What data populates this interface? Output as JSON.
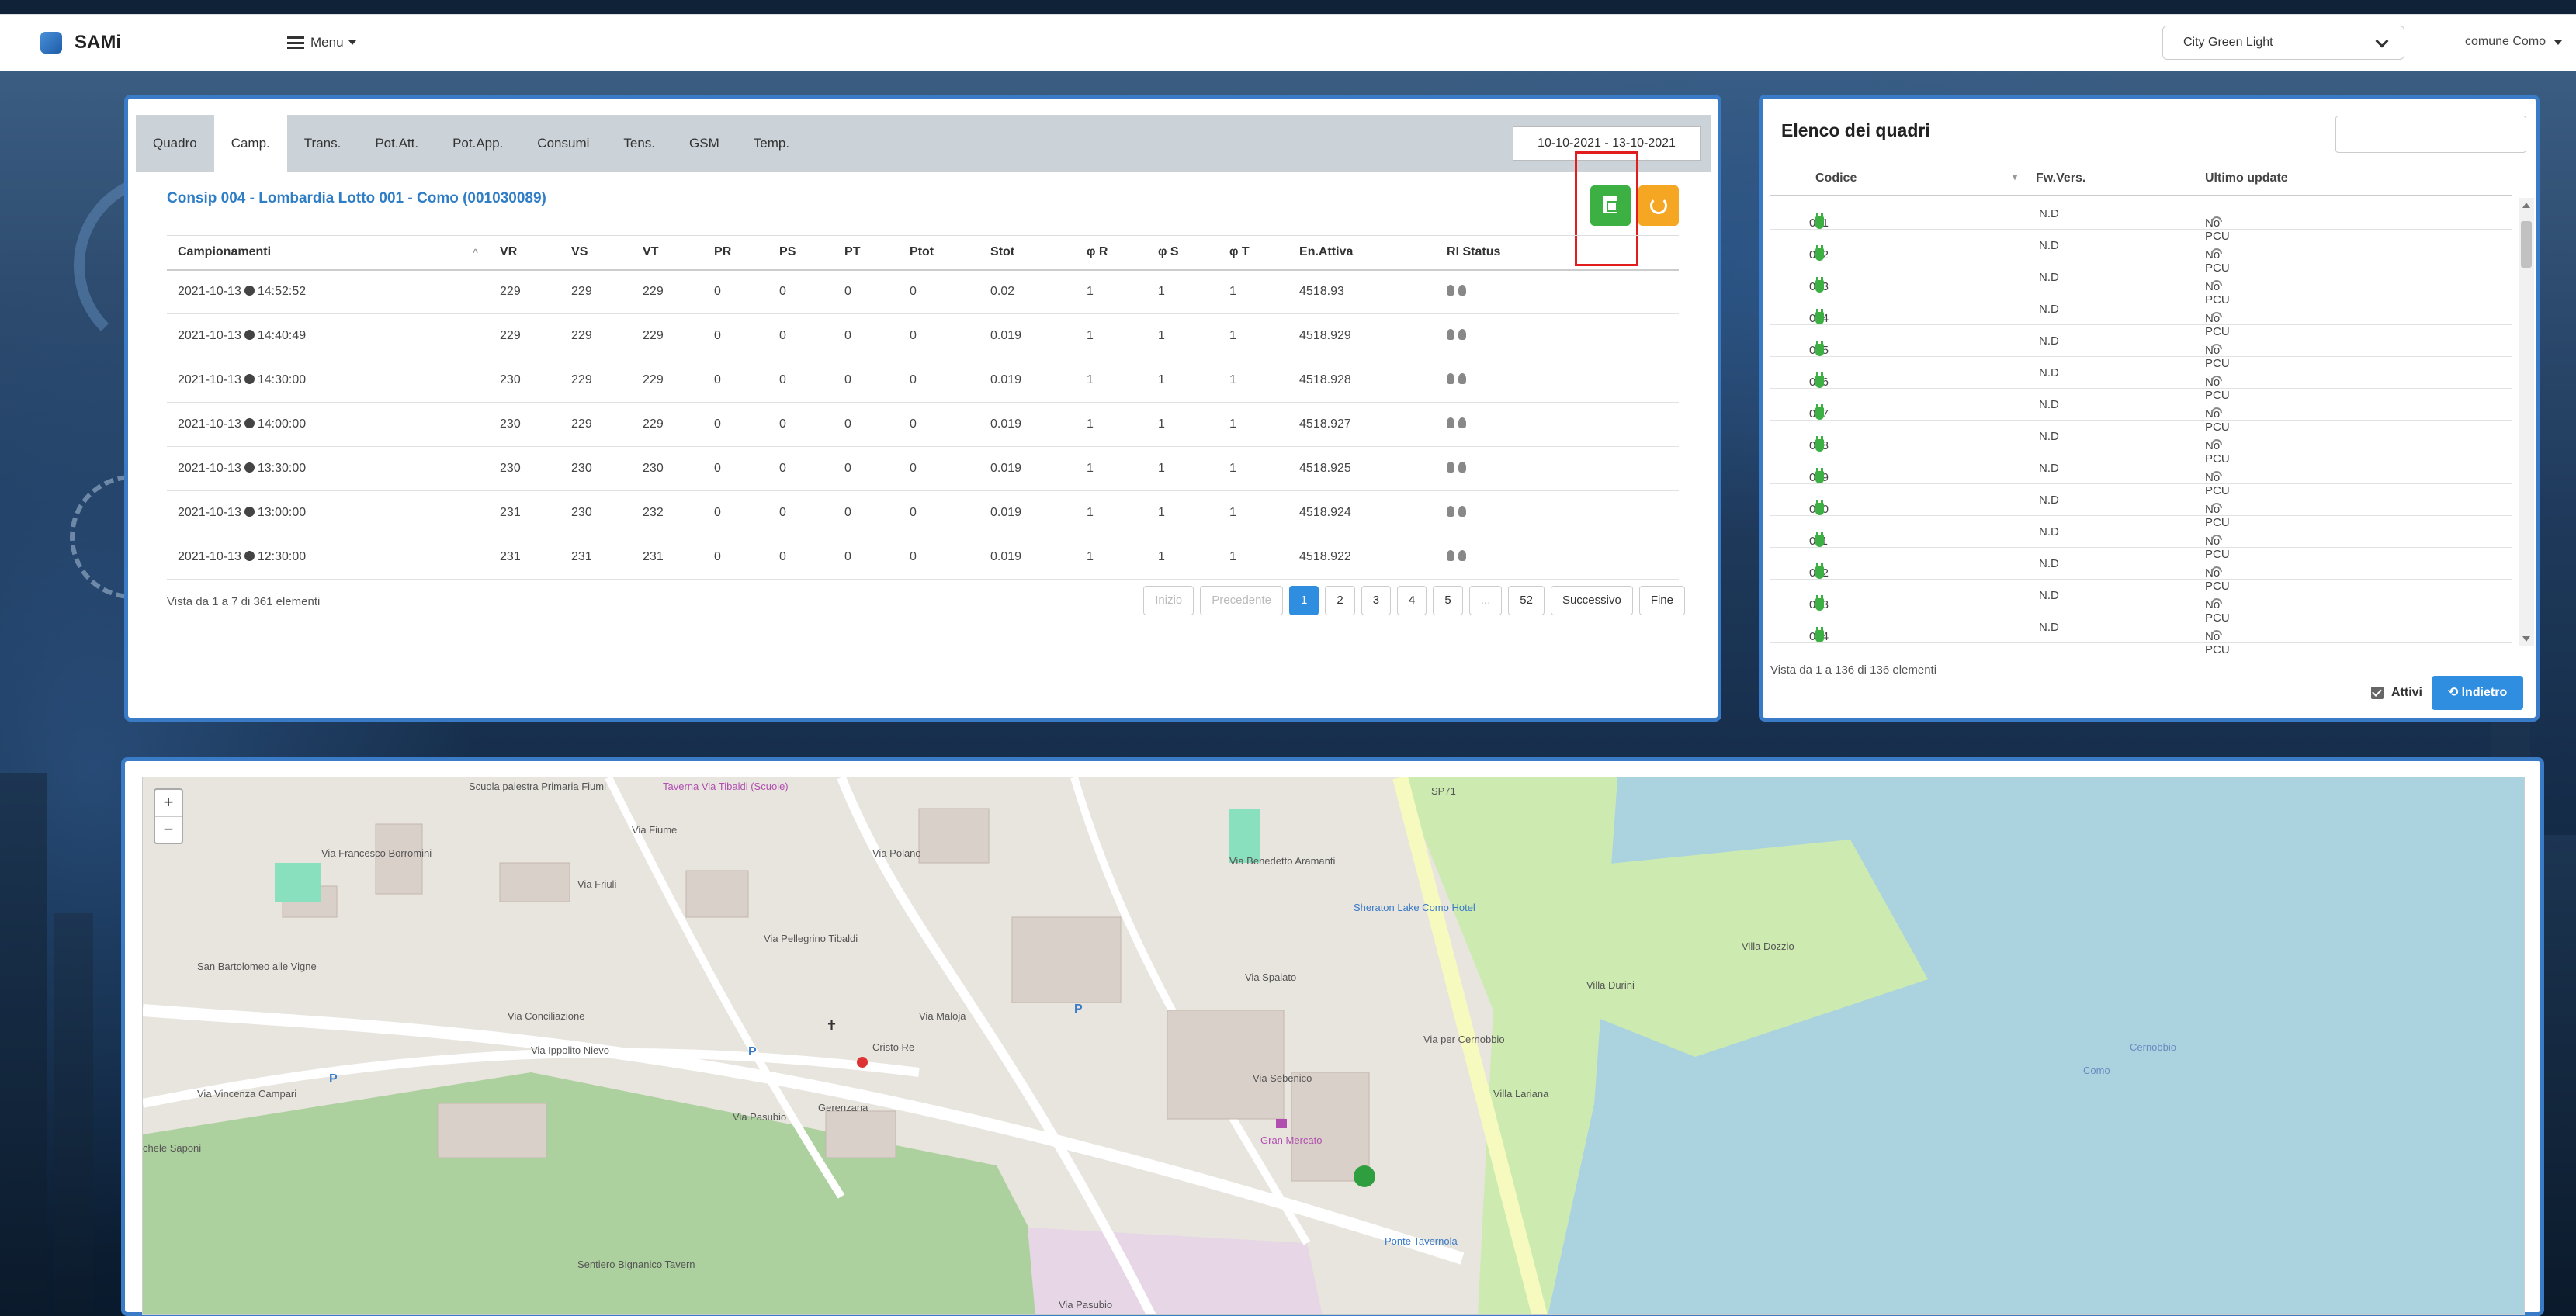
{
  "app": {
    "name": "SAMi"
  },
  "navbar": {
    "menu_label": "Menu",
    "selected_group": "City Green Light",
    "user_label": "comune Como"
  },
  "tabs": [
    "Quadro",
    "Camp.",
    "Trans.",
    "Pot.Att.",
    "Pot.App.",
    "Consumi",
    "Tens.",
    "GSM",
    "Temp."
  ],
  "active_tab": "Camp.",
  "date_range": "10-10-2021 - 13-10-2021",
  "subtitle": "Consip 004 - Lombardia Lotto 001 - Como (001030089)",
  "table": {
    "columns": [
      "Campionamenti",
      "VR",
      "VS",
      "VT",
      "PR",
      "PS",
      "PT",
      "Ptot",
      "Stot",
      "φ R",
      "φ S",
      "φ T",
      "En.Attiva",
      "RI Status"
    ],
    "rows": [
      {
        "date": "2021-10-13",
        "time": "14:52:52",
        "vr": "229",
        "vs": "229",
        "vt": "229",
        "pr": "0",
        "ps": "0",
        "pt": "0",
        "ptot": "0",
        "stot": "0.02",
        "phr": "1",
        "phs": "1",
        "pht": "1",
        "en": "4518.93"
      },
      {
        "date": "2021-10-13",
        "time": "14:40:49",
        "vr": "229",
        "vs": "229",
        "vt": "229",
        "pr": "0",
        "ps": "0",
        "pt": "0",
        "ptot": "0",
        "stot": "0.019",
        "phr": "1",
        "phs": "1",
        "pht": "1",
        "en": "4518.929"
      },
      {
        "date": "2021-10-13",
        "time": "14:30:00",
        "vr": "230",
        "vs": "229",
        "vt": "229",
        "pr": "0",
        "ps": "0",
        "pt": "0",
        "ptot": "0",
        "stot": "0.019",
        "phr": "1",
        "phs": "1",
        "pht": "1",
        "en": "4518.928"
      },
      {
        "date": "2021-10-13",
        "time": "14:00:00",
        "vr": "230",
        "vs": "229",
        "vt": "229",
        "pr": "0",
        "ps": "0",
        "pt": "0",
        "ptot": "0",
        "stot": "0.019",
        "phr": "1",
        "phs": "1",
        "pht": "1",
        "en": "4518.927"
      },
      {
        "date": "2021-10-13",
        "time": "13:30:00",
        "vr": "230",
        "vs": "230",
        "vt": "230",
        "pr": "0",
        "ps": "0",
        "pt": "0",
        "ptot": "0",
        "stot": "0.019",
        "phr": "1",
        "phs": "1",
        "pht": "1",
        "en": "4518.925"
      },
      {
        "date": "2021-10-13",
        "time": "13:00:00",
        "vr": "231",
        "vs": "230",
        "vt": "232",
        "pr": "0",
        "ps": "0",
        "pt": "0",
        "ptot": "0",
        "stot": "0.019",
        "phr": "1",
        "phs": "1",
        "pht": "1",
        "en": "4518.924"
      },
      {
        "date": "2021-10-13",
        "time": "12:30:00",
        "vr": "231",
        "vs": "231",
        "vt": "231",
        "pr": "0",
        "ps": "0",
        "pt": "0",
        "ptot": "0",
        "stot": "0.019",
        "phr": "1",
        "phs": "1",
        "pht": "1",
        "en": "4518.922"
      }
    ],
    "info": "Vista da 1 a 7 di 361 elementi"
  },
  "pagination": {
    "first": "Inizio",
    "prev": "Precedente",
    "pages": [
      "1",
      "2",
      "3",
      "4",
      "5",
      "...",
      "52"
    ],
    "active_page": "1",
    "next": "Successivo",
    "last": "Fine"
  },
  "quadri": {
    "title": "Elenco dei quadri",
    "columns": [
      "Codice",
      "Fw.Vers.",
      "Ultimo update"
    ],
    "rows": [
      {
        "code": "001",
        "fw": "N.D",
        "update": "No PCU"
      },
      {
        "code": "002",
        "fw": "N.D",
        "update": "No PCU"
      },
      {
        "code": "003",
        "fw": "N.D",
        "update": "No PCU"
      },
      {
        "code": "004",
        "fw": "N.D",
        "update": "No PCU"
      },
      {
        "code": "005",
        "fw": "N.D",
        "update": "No PCU"
      },
      {
        "code": "006",
        "fw": "N.D",
        "update": "No PCU"
      },
      {
        "code": "007",
        "fw": "N.D",
        "update": "No PCU"
      },
      {
        "code": "008",
        "fw": "N.D",
        "update": "No PCU"
      },
      {
        "code": "009",
        "fw": "N.D",
        "update": "No PCU"
      },
      {
        "code": "010",
        "fw": "N.D",
        "update": "No PCU"
      },
      {
        "code": "011",
        "fw": "N.D",
        "update": "No PCU"
      },
      {
        "code": "012",
        "fw": "N.D",
        "update": "No PCU"
      },
      {
        "code": "013",
        "fw": "N.D",
        "update": "No PCU"
      },
      {
        "code": "014",
        "fw": "N.D",
        "update": "No PCU"
      }
    ],
    "info": "Vista da 1 a 136 di 136 elementi",
    "active_label": "Attivi",
    "back_label": "Indietro"
  },
  "map": {
    "zoom_in": "+",
    "zoom_out": "−",
    "labels": [
      "San Bartolomeo alle Vigne",
      "Via Conciliazione",
      "Via Ippolito Nievo",
      "Via Vincenza Campari",
      "Via Pasubio",
      "Gerenzana",
      "Cristo Re",
      "Via Maloja",
      "Via Polano",
      "Via Spalato",
      "Via Sebenico",
      "Via Benedetto Aramanti",
      "Sheraton Lake Como Hotel",
      "Villa Dozzio",
      "Villa Durini",
      "Villa Lariana",
      "Gran Mercato",
      "Via per Cernobbio",
      "Via Fiume",
      "Via Friuli",
      "Via Francesco Borromini",
      "Scuola palestra Primaria Fiumi",
      "Taverna Via Tibaldi (Scuole)",
      "SP71",
      "Como",
      "Cernobbio",
      "Via Pellegrino Tibaldi",
      "Sentiero Bignanico Tavern",
      "Via Pasubio",
      "Ponte Tavernola",
      "chele Saponi"
    ],
    "icons": [
      "parking-icon",
      "church-icon",
      "charging-station-icon",
      "restaurant-icon",
      "shop-icon"
    ]
  }
}
